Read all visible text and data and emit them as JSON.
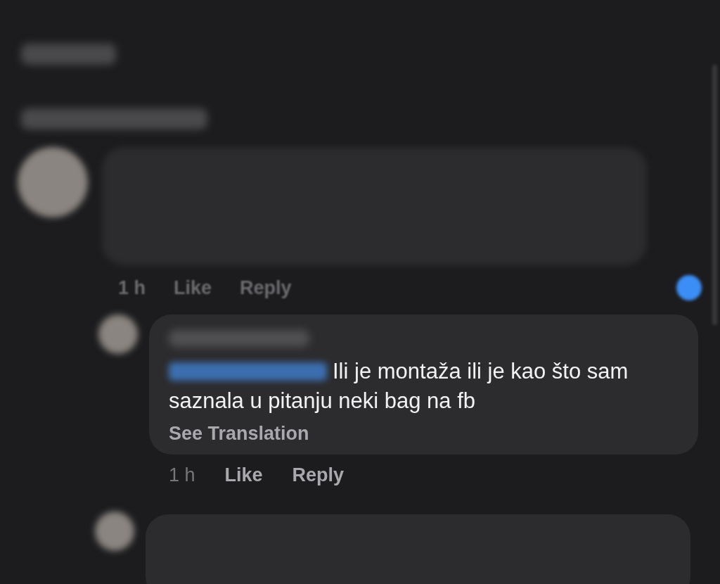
{
  "comments": [
    {
      "kind": "blurred",
      "time": "1 h",
      "actions": [
        "Like",
        "Reply"
      ],
      "reacted": true
    },
    {
      "kind": "reply",
      "body_lines": [
        "Ili je montaža ili je kao što sam",
        "saznala u pitanju neki bag na fb"
      ],
      "translate": "See Translation",
      "time": "1 h",
      "actions": [
        "Like",
        "Reply"
      ]
    }
  ]
}
